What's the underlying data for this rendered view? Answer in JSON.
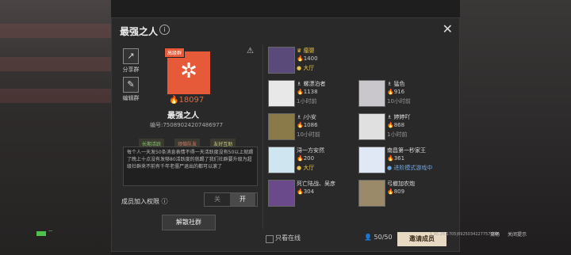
{
  "title": "最强之人",
  "info_icon": "i",
  "close_icon": "✕",
  "side": {
    "share_label": "分享群",
    "edit_label": "编辑群"
  },
  "group": {
    "badge": "高级群",
    "score": "18097",
    "name": "最强之人",
    "id_text": "编号:75089024207486977",
    "tags": [
      "长期活跃",
      "烦恼队友",
      "友好互助"
    ],
    "description": "每个人一天发50条消息表情不得一天活跃度没有50以上就踢了晚上十点没有发够80活跃度的就踢了我们社群要升级为超级社群来不前有千年老僵尸退出的都可以滚了"
  },
  "permission": {
    "label": "成员加入权限",
    "off": "关",
    "on": "开"
  },
  "disband_label": "解散社群",
  "members": [
    {
      "name": "瘤婴",
      "power": "1400",
      "status": "大厅",
      "status_type": "green",
      "leader": true
    },
    {
      "name": "螺漂泊者",
      "power": "1138",
      "status": "1小时前",
      "status_type": "gray"
    },
    {
      "name": "猛色",
      "power": "916",
      "status": "10小时前",
      "status_type": "gray"
    },
    {
      "name": "/小安",
      "power": "1086",
      "status": "10小时前",
      "status_type": "gray"
    },
    {
      "name": "婷婷吖",
      "power": "868",
      "status": "1小时前",
      "status_type": "gray"
    },
    {
      "name": "浔一方安然",
      "power": "200",
      "status": "大厅",
      "status_type": "green"
    },
    {
      "name": "南昌第一秒家王",
      "power": "361",
      "status": "进阶模式游戏中",
      "status_type": "blue"
    },
    {
      "name": "死亡陆战、吴彦",
      "power": "304",
      "status": "",
      "status_type": "gray"
    },
    {
      "name": "弓撤加农炮",
      "power": "809",
      "status": "",
      "status_type": "gray"
    }
  ],
  "bottom": {
    "online_label": "只看在线",
    "count": "50/50",
    "invite_label": "邀请成员"
  },
  "footer": {
    "version": "1.95.26.1705|6925034227757609",
    "btn1": "流畅",
    "btn2": "关闭提示"
  },
  "colors": {
    "accent": "#e65a3a",
    "invite_bg": "#e8dac2",
    "panel": "#2a2929"
  }
}
